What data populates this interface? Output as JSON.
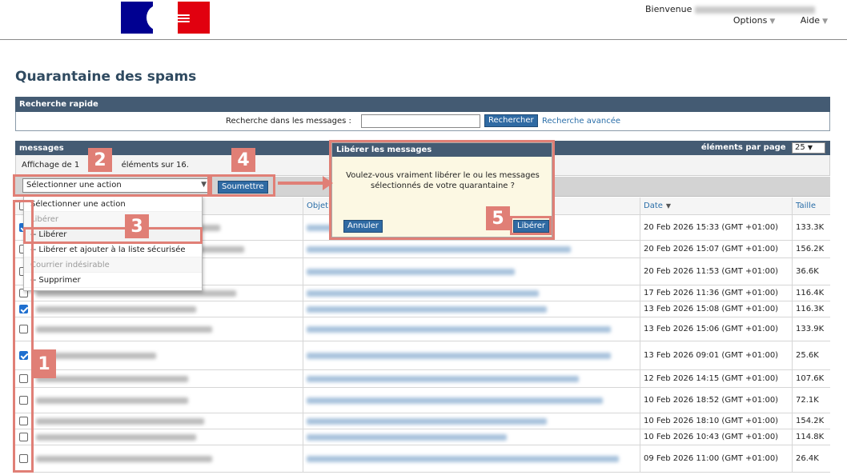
{
  "header": {
    "welcome_label": "Bienvenue",
    "menu": [
      {
        "label": "Options"
      },
      {
        "label": "Aide"
      }
    ]
  },
  "page": {
    "title": "Quarantaine des spams"
  },
  "quick_search": {
    "title": "Recherche rapide",
    "label": "Recherche dans les messages :",
    "input_value": "",
    "search_button": "Rechercher",
    "advanced_link": "Recherche avancée"
  },
  "messages_panel": {
    "title": "messages",
    "per_page_label": "éléments par page",
    "per_page_value": "25",
    "info_prefix": "Affichage de 1",
    "info_suffix": "éléments sur 16.",
    "action_select_value": "Sélectionner une action",
    "submit_button": "Soumettre"
  },
  "action_dropdown": {
    "items": [
      {
        "label": "Sélectionner une action",
        "type": "option"
      },
      {
        "label": "Libérer",
        "type": "group"
      },
      {
        "label": "-- Libérer",
        "type": "option"
      },
      {
        "label": "-- Libérer et ajouter à la liste sécurisée",
        "type": "option"
      },
      {
        "label": "Courrier indésirable",
        "type": "group"
      },
      {
        "label": "-- Supprimer",
        "type": "option"
      }
    ]
  },
  "table": {
    "columns": {
      "subject": "Objet",
      "date": "Date",
      "size": "Taille"
    },
    "rows": [
      {
        "checked": true,
        "date": "20 Feb 2026 15:33 (GMT +01:00)",
        "size": "133.3K"
      },
      {
        "checked": false,
        "date": "20 Feb 2026 15:07 (GMT +01:00)",
        "size": "156.2K"
      },
      {
        "checked": false,
        "date": "20 Feb 2026 11:53 (GMT +01:00)",
        "size": "36.6K"
      },
      {
        "checked": false,
        "date": "17 Feb 2026 11:36 (GMT +01:00)",
        "size": "116.4K"
      },
      {
        "checked": true,
        "date": "13 Feb 2026 15:08 (GMT +01:00)",
        "size": "116.3K"
      },
      {
        "checked": false,
        "date": "13 Feb 2026 15:06 (GMT +01:00)",
        "size": "133.9K"
      },
      {
        "checked": true,
        "date": "13 Feb 2026 09:01 (GMT +01:00)",
        "size": "25.6K"
      },
      {
        "checked": false,
        "date": "12 Feb 2026 14:15 (GMT +01:00)",
        "size": "107.6K"
      },
      {
        "checked": false,
        "date": "10 Feb 2026 18:52 (GMT +01:00)",
        "size": "72.1K"
      },
      {
        "checked": false,
        "date": "10 Feb 2026 18:10 (GMT +01:00)",
        "size": "154.2K"
      },
      {
        "checked": false,
        "date": "10 Feb 2026 10:43 (GMT +01:00)",
        "size": "114.8K"
      },
      {
        "checked": false,
        "date": "09 Feb 2026 11:00 (GMT +01:00)",
        "size": "26.4K"
      }
    ]
  },
  "dialog": {
    "title": "Libérer les messages",
    "message": "Voulez-vous vraiment libérer le ou les messages sélectionnés de votre quarantaine ?",
    "cancel_button": "Annuler",
    "confirm_button": "Libérer"
  },
  "annotations": {
    "badges": [
      "1",
      "2",
      "3",
      "4",
      "5"
    ],
    "color": "#e07f76"
  }
}
